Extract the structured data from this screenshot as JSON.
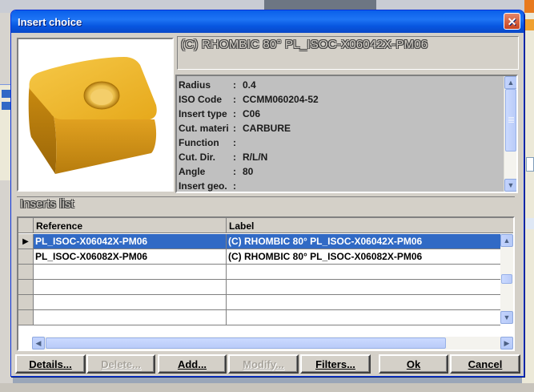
{
  "dialog": {
    "title": "Insert choice",
    "close_glyph": "✕",
    "insert_title": "(C) RHOMBIC 80° PL_ISOC-X06042X-PM06",
    "image_icon": "rhombic-insert-3d-icon"
  },
  "properties": [
    {
      "key": "Radius",
      "value": "0.4"
    },
    {
      "key": "ISO Code",
      "value": "CCMM060204-52"
    },
    {
      "key": "Insert type",
      "value": "C06"
    },
    {
      "key": "Cut. materi",
      "value": "CARBURE"
    },
    {
      "key": "Function",
      "value": ""
    },
    {
      "key": "Cut. Dir.",
      "value": "R/L/N"
    },
    {
      "key": "Angle",
      "value": "80"
    },
    {
      "key": "Insert geo.",
      "value": ""
    }
  ],
  "list": {
    "title": "Inserts list",
    "columns": [
      "Reference",
      "Label"
    ],
    "rows": [
      {
        "reference": "PL_ISOC-X06042X-PM06",
        "label": "(C) RHOMBIC 80° PL_ISOC-X06042X-PM06",
        "selected": true
      },
      {
        "reference": "PL_ISOC-X06082X-PM06",
        "label": "(C) RHOMBIC 80° PL_ISOC-X06082X-PM06",
        "selected": false
      }
    ],
    "row_pointer": "▶"
  },
  "buttons": {
    "details": "Details...",
    "delete": "Delete...",
    "add": "Add...",
    "modify": "Modify...",
    "filters": "Filters...",
    "ok": "Ok",
    "cancel": "Cancel"
  },
  "colors": {
    "titlebar": "#0a5fea",
    "selection": "#316ac5",
    "insert_gold": "#e0a616"
  }
}
